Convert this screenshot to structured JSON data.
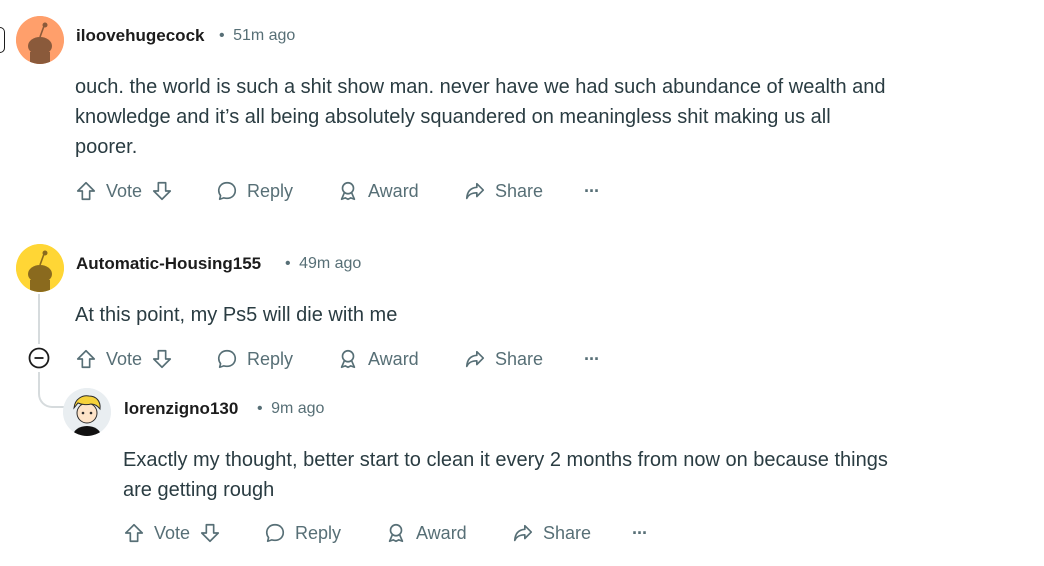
{
  "comments": [
    {
      "username": "iloovehugecock",
      "time": "51m ago",
      "avatar_color": "#ff9f6b",
      "text_lines": [
        "ouch. the world is such a shit show man. never have we had such abundance of wealth and",
        "knowledge and it’s all being absolutely squandered on meaningless shit making us all",
        "poorer."
      ]
    },
    {
      "username": "Automatic-Housing155",
      "time": "49m ago",
      "avatar_color": "#ffd635",
      "text_lines": [
        "At this point, my Ps5 will die with me"
      ]
    },
    {
      "username": "lorenzigno130",
      "time": "9m ago",
      "avatar_color": "#e9eef1",
      "text_lines": [
        "Exactly my thought, better start to clean it every 2 months from now on because things",
        "are getting rough"
      ]
    }
  ],
  "actions": {
    "vote": "Vote",
    "reply": "Reply",
    "award": "Award",
    "share": "Share",
    "more": "···"
  },
  "meta_separator": "•",
  "icons": [
    "upvote-icon",
    "downvote-icon",
    "reply-icon",
    "award-icon",
    "share-icon",
    "more-icon",
    "collapse-icon"
  ]
}
